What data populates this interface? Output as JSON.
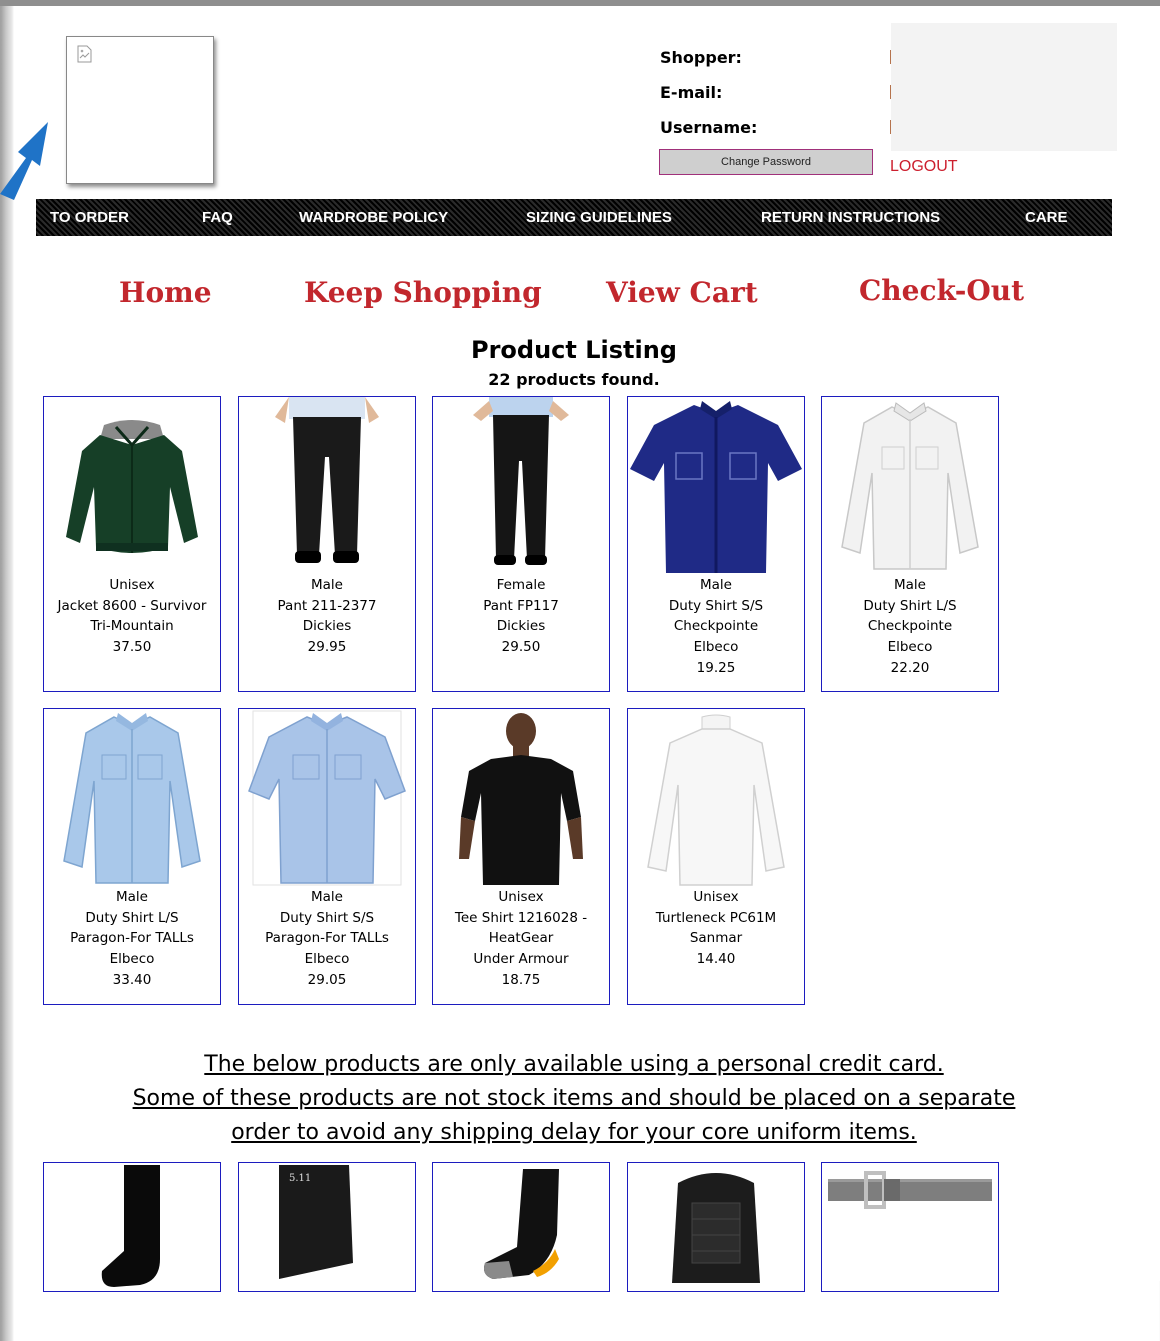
{
  "user": {
    "shopper_label": "Shopper:",
    "email_label": "E-mail:",
    "username_label": "Username:",
    "change_password_label": "Change Password",
    "logout_label": "LOGOUT"
  },
  "nav": [
    "TO ORDER",
    "FAQ",
    "WARDROBE POLICY",
    "SIZING GUIDELINES",
    "RETURN INSTRUCTIONS",
    "CARE"
  ],
  "links": {
    "home": "Home",
    "keep_shopping": "Keep Shopping",
    "view_cart": "View Cart",
    "checkout": "Check-Out"
  },
  "listing": {
    "title": "Product Listing",
    "count": "22 products found."
  },
  "products_row1": [
    {
      "gender": "Unisex",
      "name": "Jacket 8600 - Survivor",
      "lines": [
        "Tri-Mountain"
      ],
      "price": "37.50",
      "image": "green-jacket"
    },
    {
      "gender": "Male",
      "name": "Pant 211-2377",
      "lines": [
        "Dickies"
      ],
      "price": "29.95",
      "image": "black-pants-male"
    },
    {
      "gender": "Female",
      "name": "Pant FP117",
      "lines": [
        "Dickies"
      ],
      "price": "29.50",
      "image": "black-pants-female"
    },
    {
      "gender": "Male",
      "name": "Duty Shirt S/S",
      "lines": [
        "Checkpointe",
        "Elbeco"
      ],
      "price": "19.25",
      "image": "navy-shirt"
    },
    {
      "gender": "Male",
      "name": "Duty Shirt L/S",
      "lines": [
        "Checkpointe",
        "Elbeco"
      ],
      "price": "22.20",
      "image": "white-shirt"
    }
  ],
  "products_row2": [
    {
      "gender": "Male",
      "name": "Duty Shirt L/S",
      "lines": [
        "Paragon-For TALLs",
        "Elbeco"
      ],
      "price": "33.40",
      "image": "blue-shirt-long"
    },
    {
      "gender": "Male",
      "name": "Duty Shirt S/S",
      "lines": [
        "Paragon-For TALLs",
        "Elbeco"
      ],
      "price": "29.05",
      "image": "blue-shirt-short"
    },
    {
      "gender": "Unisex",
      "name": "Tee Shirt 1216028 -",
      "lines": [
        "HeatGear",
        "Under Armour"
      ],
      "price": "18.75",
      "image": "black-tee"
    },
    {
      "gender": "Unisex",
      "name": "Turtleneck PC61M",
      "lines": [
        "Sanmar"
      ],
      "price": "14.40",
      "image": "white-turtleneck"
    }
  ],
  "notice": {
    "line1": "The below products are only available using a personal credit card.",
    "line2": "Some of these products are not stock items and should be placed on a separate",
    "line3": "order to avoid any shipping delay for your core uniform items."
  },
  "products_row3": [
    {
      "image": "black-sock"
    },
    {
      "image": "black-sock-511",
      "brand_text": "5.11"
    },
    {
      "image": "performance-sock"
    },
    {
      "image": "black-backpack"
    },
    {
      "image": "duty-belt"
    }
  ],
  "colors": {
    "link_red": "#c2272d",
    "card_border": "#1c1cbf",
    "arrow_blue": "#1f73c7"
  }
}
